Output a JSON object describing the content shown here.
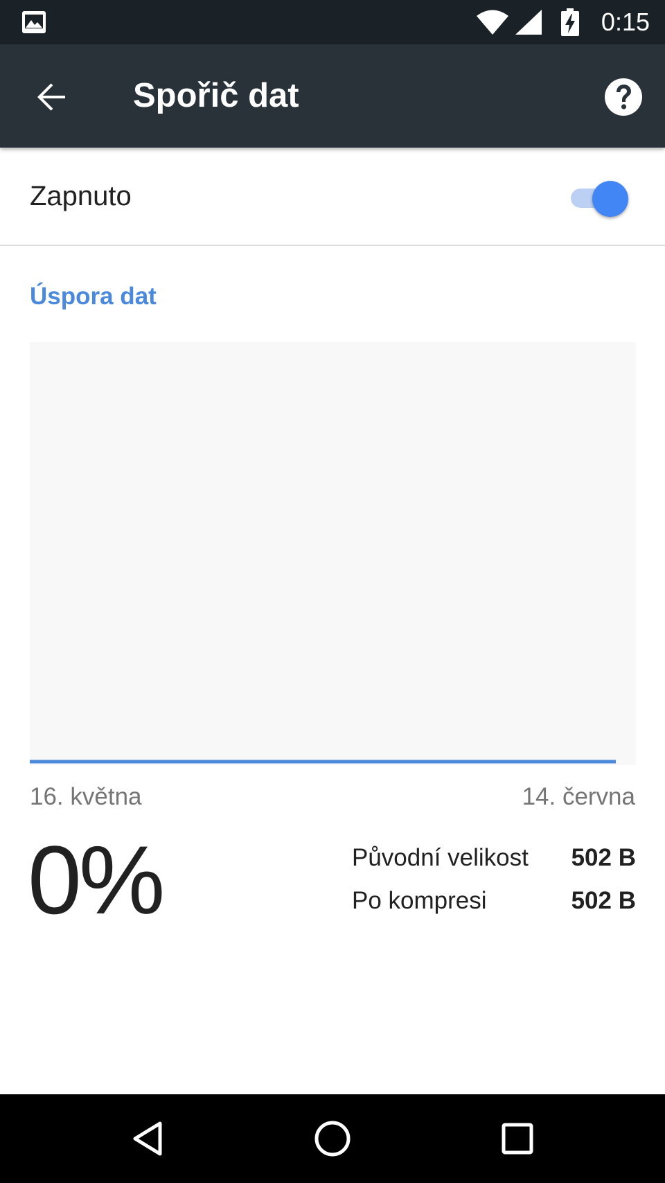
{
  "status_bar": {
    "time": "0:15",
    "icons": [
      "gallery-icon",
      "wifi-icon",
      "signal-icon",
      "battery-charging-icon"
    ]
  },
  "app_bar": {
    "title": "Spořič dat",
    "back_icon": "arrow-back-icon",
    "help_icon": "help-icon"
  },
  "toggle": {
    "label": "Zapnuto",
    "state": true,
    "accent_color": "#4285f4"
  },
  "section": {
    "title": "Úspora dat"
  },
  "chart": {
    "start_date": "16. května",
    "end_date": "14. června",
    "line_color": "#4a89dc",
    "background_color": "#f8f8f8"
  },
  "chart_data": {
    "type": "line",
    "x": [
      "16. května",
      "14. června"
    ],
    "series": [
      {
        "values": [
          0,
          0
        ]
      }
    ],
    "title": "",
    "xlabel": "",
    "ylabel": "",
    "grid": false
  },
  "summary": {
    "percent": "0%",
    "rows": [
      {
        "label": "Původní velikost",
        "value": "502 B"
      },
      {
        "label": "Po kompresi",
        "value": "502 B"
      }
    ]
  },
  "nav_bar": {
    "icons": [
      "nav-back-icon",
      "nav-home-icon",
      "nav-recents-icon"
    ]
  }
}
